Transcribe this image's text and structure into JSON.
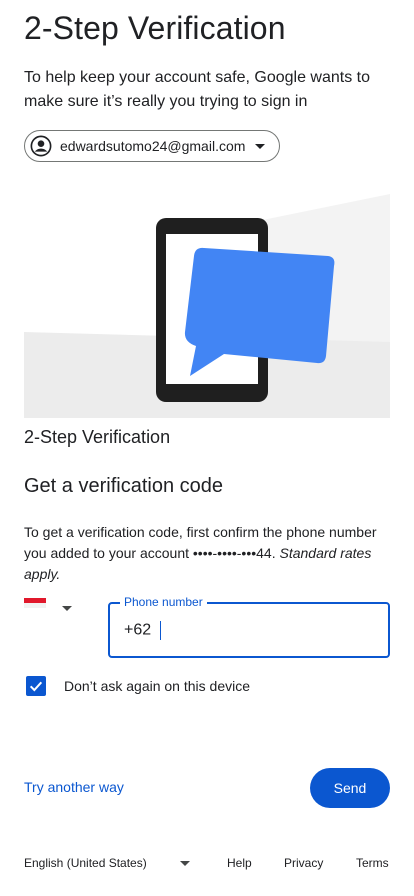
{
  "header": {
    "title": "2-Step Verification",
    "subtitle": "To help keep your account safe, Google wants to make sure it’s really you trying to sign in"
  },
  "account": {
    "email": "edwardsutomo24@gmail.com",
    "avatar_icon": "account-circle-icon"
  },
  "illustration": {
    "icon": "phone-with-chat-bubble-illustration",
    "bubble_color": "#4285f4"
  },
  "section": {
    "heading": "2-Step Verification",
    "subheading": "Get a verification code",
    "description": "To get a verification code, first confirm the phone number you added to your account ••••-••••-•••44. ",
    "rates_note": "Standard rates apply."
  },
  "phone": {
    "country_flag": "indonesia-flag-icon",
    "label": "Phone number",
    "value": "+62 "
  },
  "remember": {
    "label": "Don’t ask again on this device",
    "checked": true
  },
  "actions": {
    "try_another": "Try another way",
    "send": "Send"
  },
  "footer": {
    "language": "English (United States)",
    "help": "Help",
    "privacy": "Privacy",
    "terms": "Terms"
  },
  "colors": {
    "primary": "#0b57d0",
    "text": "#202124"
  }
}
